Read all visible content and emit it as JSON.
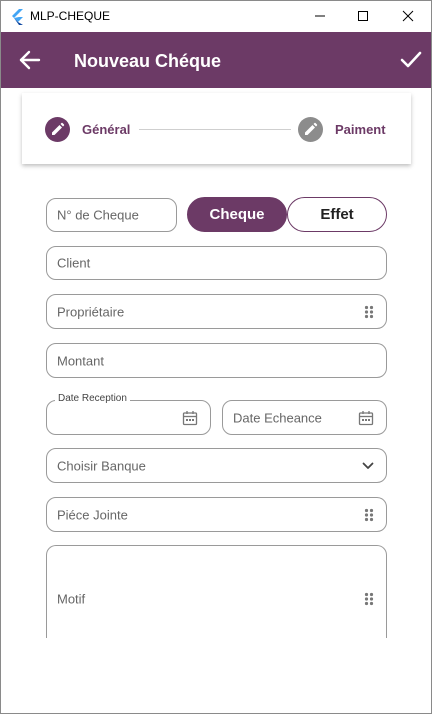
{
  "window": {
    "title": "MLP-CHEQUE"
  },
  "appbar": {
    "title": "Nouveau Chéque",
    "background": "#6c3a66"
  },
  "stepper": {
    "steps": [
      {
        "label": "Général",
        "active": true,
        "icon": "edit-icon"
      },
      {
        "label": "Paiment",
        "active": false,
        "icon": "edit-icon"
      }
    ]
  },
  "form": {
    "numero_cheque": {
      "placeholder": "N° de Cheque"
    },
    "type_toggle": {
      "options": [
        "Cheque",
        "Effet"
      ],
      "selected": "Cheque"
    },
    "client": {
      "placeholder": "Client"
    },
    "proprietaire": {
      "placeholder": "Propriétaire",
      "icon": "drag-dots-icon"
    },
    "montant": {
      "placeholder": "Montant"
    },
    "date_reception": {
      "label": "Date Reception",
      "icon": "calendar-icon"
    },
    "date_echeance": {
      "placeholder": "Date Echeance",
      "icon": "calendar-icon"
    },
    "banque": {
      "placeholder": "Choisir Banque",
      "icon": "chevron-down-icon"
    },
    "piece_jointe": {
      "placeholder": "Piéce Jointe",
      "icon": "drag-dots-icon"
    },
    "motif": {
      "placeholder": "Motif",
      "icon": "drag-dots-icon"
    }
  },
  "colors": {
    "accent": "#6c3a66",
    "inactive_step": "#8c8c8c",
    "border": "#9a9a9a"
  }
}
